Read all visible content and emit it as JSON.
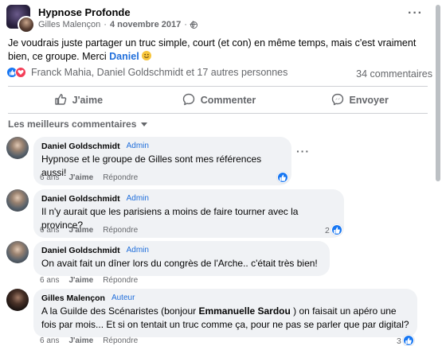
{
  "post": {
    "group_name": "Hypnose Profonde",
    "author": "Gilles Malençon",
    "separator": "·",
    "date": "4 novembre 2017",
    "privacy_icon": "globe-icon",
    "more_label": "···",
    "text": "Je voudrais juste partager un truc simple, court (et con) en même temps, mais c'est vraiment bien, ce groupe. Merci ",
    "mention": "Daniel",
    "emoji": "smiley-emoji"
  },
  "reactions": {
    "names": "Franck Mahia, Daniel Goldschmidt et 17 autres personnes",
    "comments_count": "34 commentaires",
    "icons": [
      "like-reaction-icon",
      "love-reaction-icon"
    ]
  },
  "actions": {
    "like": "J'aime",
    "comment": "Commenter",
    "share": "Envoyer"
  },
  "best_comments_label": "Les meilleurs commentaires",
  "comments": [
    {
      "name": "Daniel Goldschmidt",
      "badge": "Admin",
      "text": "Hypnose et le groupe de Gilles sont mes références aussi!",
      "time": "6 ans",
      "like": "J'aime",
      "reply": "Répondre",
      "reaction_count": "",
      "more": "···"
    },
    {
      "name": "Daniel Goldschmidt",
      "badge": "Admin",
      "text": "Il n'y aurait que les parisiens a moins de faire tourner avec la province?",
      "time": "6 ans",
      "like": "J'aime",
      "reply": "Répondre",
      "reaction_count": "2"
    },
    {
      "name": "Daniel Goldschmidt",
      "badge": "Admin",
      "text": "On avait fait un dîner lors du congrès de l'Arche.. c'était très bien!",
      "time": "6 ans",
      "like": "J'aime",
      "reply": "Répondre",
      "reaction_count": ""
    },
    {
      "name": "Gilles Malençon",
      "badge": "Auteur",
      "text_before": "A la Guilde des Scénaristes (bonjour ",
      "text_bold": "Emmanuelle Sardou",
      "text_after": " ) on faisait un apéro une fois par mois... Et si on tentait un truc comme ça, pour ne pas se parler que par digital?",
      "time": "6 ans",
      "like": "J'aime",
      "reply": "Répondre",
      "reaction_count": "3"
    }
  ],
  "colors": {
    "accent": "#1877f2",
    "mention": "#216fdb",
    "muted": "#65676b",
    "bubble": "#f0f2f5"
  }
}
